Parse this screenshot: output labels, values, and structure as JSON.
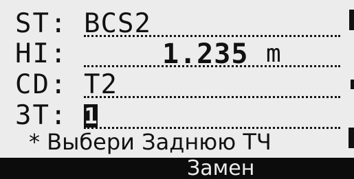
{
  "fields": {
    "st": {
      "label": "ST:",
      "value": "BCS2"
    },
    "hi": {
      "label": "HI:",
      "value": "1.235",
      "unit": "m"
    },
    "cd": {
      "label": "CD:",
      "value": "T2"
    },
    "bs": {
      "label": "ЗТ:",
      "value": "1"
    }
  },
  "prompt": "* Выбери Заднюю ТЧ",
  "softkeys": {
    "replace": "Замен"
  },
  "colors": {
    "screen_bg": "#ececec",
    "text": "#111111",
    "softkey_bar": "#0c0c0c"
  }
}
